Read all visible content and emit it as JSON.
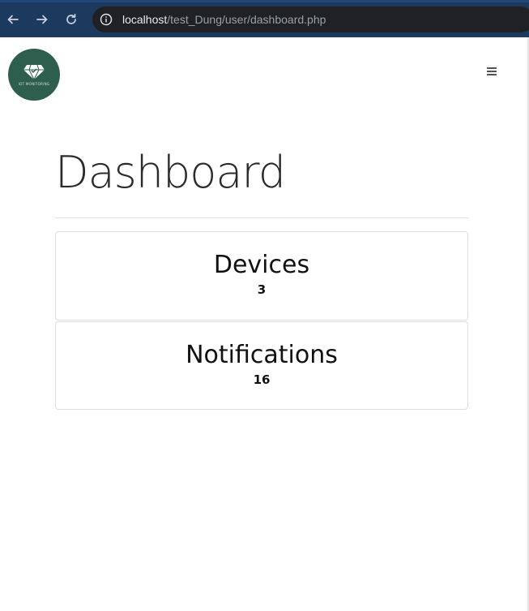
{
  "browser": {
    "url_host": "localhost",
    "url_path": "/test_Dung/user/dashboard.php"
  },
  "header": {
    "logo_text": "IOT MONITORING",
    "menu_icon": "hamburger-icon"
  },
  "main": {
    "title": "Dashboard",
    "cards": [
      {
        "title": "Devices",
        "value": "3"
      },
      {
        "title": "Notifications",
        "value": "16"
      }
    ]
  },
  "colors": {
    "browser_bar": "#1c3a5e",
    "url_box": "#202124",
    "logo_bg": "#2e5e4e"
  }
}
